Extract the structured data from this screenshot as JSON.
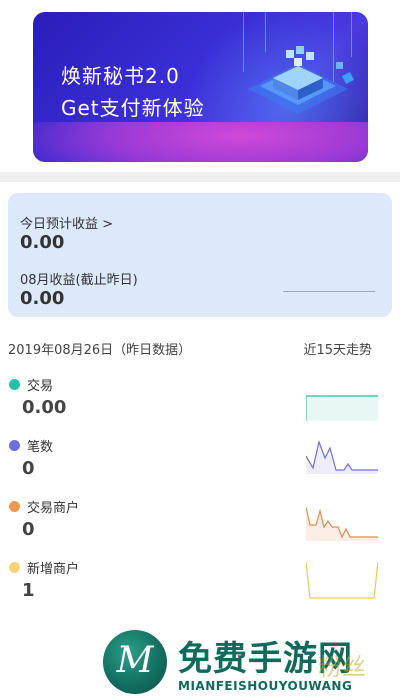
{
  "banner": {
    "line1": "焕新秘书2.0",
    "line2": "Get支付新体验"
  },
  "earnings": {
    "today_label": "今日预计收益 >",
    "today_value": "0.00",
    "month_label": "08月收益(截止昨日)",
    "month_value": "0.00"
  },
  "date_row": {
    "left": "2019年08月26日（昨日数据）",
    "right": "近15天走势"
  },
  "metrics": [
    {
      "label": "交易",
      "value": "0.00",
      "color": "#27bfa8"
    },
    {
      "label": "笔数",
      "value": "0",
      "color": "#6f6ee0"
    },
    {
      "label": "交易商户",
      "value": "0",
      "color": "#f0984e"
    },
    {
      "label": "新增商户",
      "value": "1",
      "color": "#f6d476"
    }
  ],
  "watermark": {
    "logo_letter": "M",
    "title": "免费手游网",
    "subtitle": "MIANFEISHOUYOUWANG",
    "overlay": "粉丝"
  }
}
